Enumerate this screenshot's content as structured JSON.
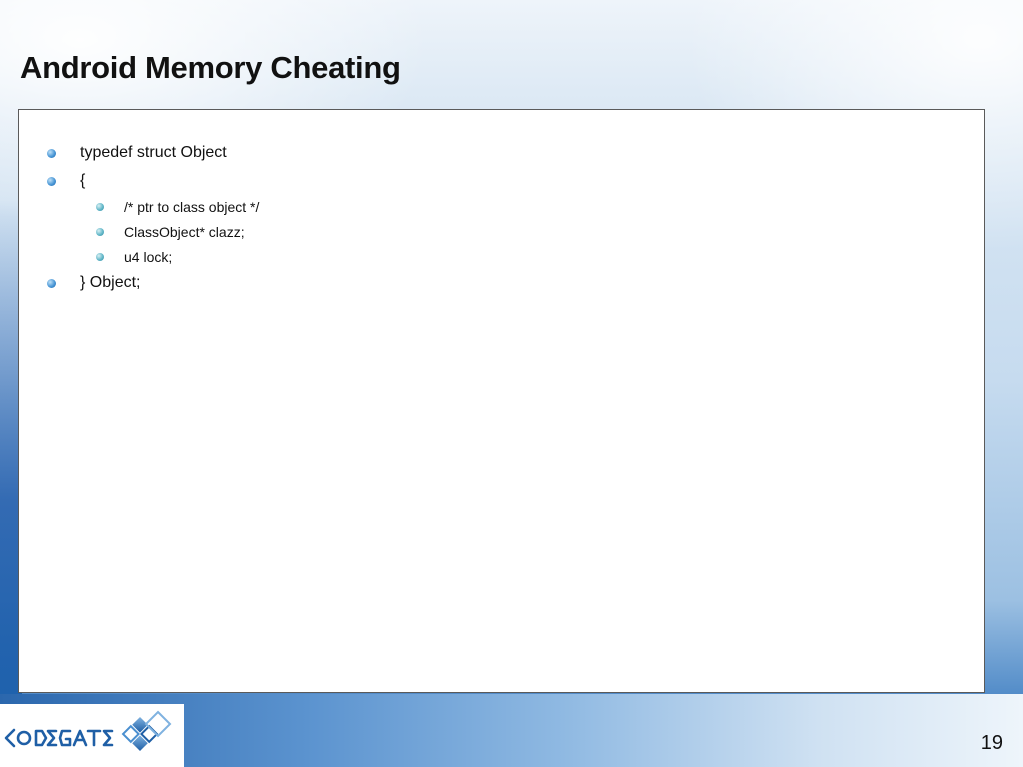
{
  "slide": {
    "title": "Android Memory Cheating",
    "page_number": "19"
  },
  "content": {
    "bullets": [
      {
        "level": 1,
        "text": "typedef struct Object"
      },
      {
        "level": 1,
        "text": "{"
      },
      {
        "level": 2,
        "text": "/* ptr to class object */"
      },
      {
        "level": 2,
        "text": "ClassObject* clazz;"
      },
      {
        "level": 2,
        "text": "u4 lock;"
      },
      {
        "level": 1,
        "text": "} Object;"
      }
    ]
  },
  "logo": {
    "icon": "codegate-logo-icon",
    "alt": "CODEGATE"
  },
  "colors": {
    "title": "#111111",
    "bullet_primary": "#4a97d6",
    "bullet_secondary": "#64b8c9",
    "box_border": "#5a5a5a",
    "brand_blue": "#2d6fb7"
  }
}
